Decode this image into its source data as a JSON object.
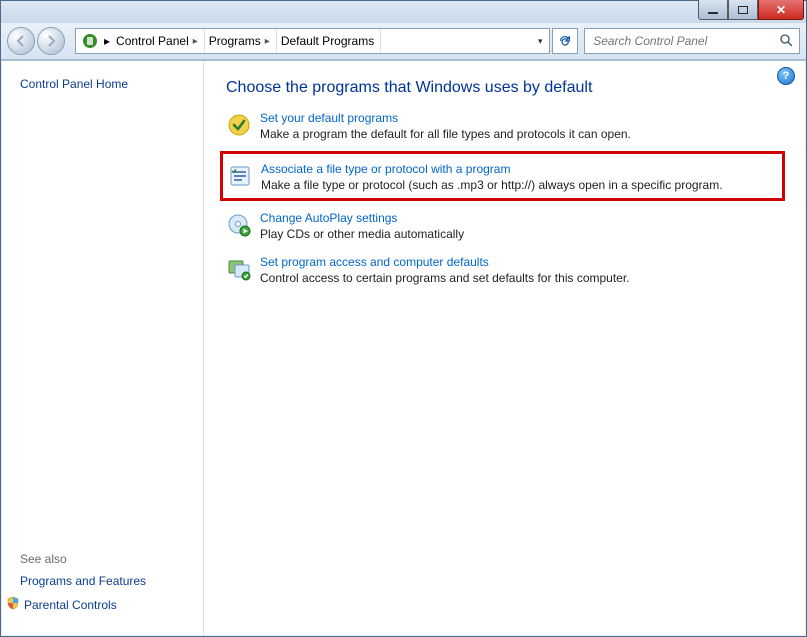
{
  "breadcrumb": {
    "segments": [
      "Control Panel",
      "Programs",
      "Default Programs"
    ]
  },
  "search": {
    "placeholder": "Search Control Panel"
  },
  "sidebar": {
    "home": "Control Panel Home",
    "seealso_label": "See also",
    "links": {
      "programs_features": "Programs and Features",
      "parental_controls": "Parental Controls"
    }
  },
  "main": {
    "heading": "Choose the programs that Windows uses by default",
    "tasks": [
      {
        "link": "Set your default programs",
        "desc": "Make a program the default for all file types and protocols it can open."
      },
      {
        "link": "Associate a file type or protocol with a program",
        "desc": "Make a file type or protocol (such as .mp3 or http://) always open in a specific program."
      },
      {
        "link": "Change AutoPlay settings",
        "desc": "Play CDs or other media automatically"
      },
      {
        "link": "Set program access and computer defaults",
        "desc": "Control access to certain programs and set defaults for this computer."
      }
    ]
  }
}
